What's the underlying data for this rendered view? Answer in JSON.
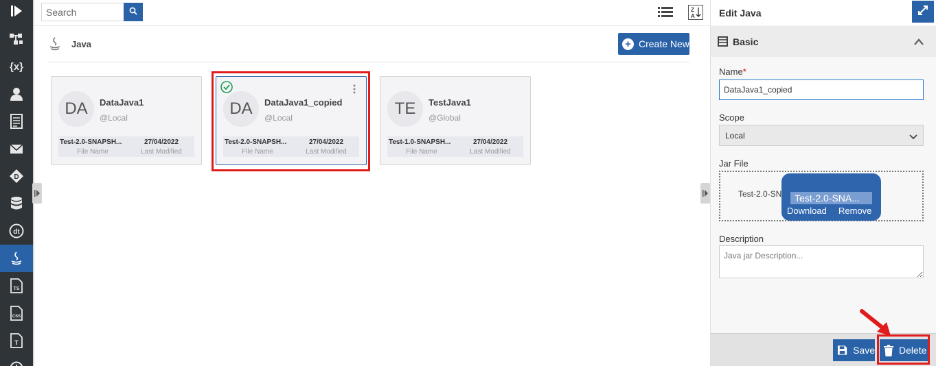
{
  "search": {
    "placeholder": "Search"
  },
  "header": {
    "title": "Java",
    "create_label": "Create New"
  },
  "cards": [
    {
      "initials": "DA",
      "name": "DataJava1",
      "scope": "@Local",
      "file": "Test-2.0-SNAPSH...",
      "date": "27/04/2022",
      "file_label": "File Name",
      "date_label": "Last Modified"
    },
    {
      "initials": "DA",
      "name": "DataJava1_copied",
      "scope": "@Local",
      "file": "Test-2.0-SNAPSH...",
      "date": "27/04/2022",
      "file_label": "File Name",
      "date_label": "Last Modified"
    },
    {
      "initials": "TE",
      "name": "TestJava1",
      "scope": "@Global",
      "file": "Test-1.0-SNAPSH...",
      "date": "27/04/2022",
      "file_label": "File Name",
      "date_label": "Last Modified"
    }
  ],
  "panel": {
    "title": "Edit Java",
    "section": "Basic",
    "name_label": "Name",
    "required_mark": "*",
    "name_value": "DataJava1_copied",
    "scope_label": "Scope",
    "scope_value": "Local",
    "jar_label": "Jar File",
    "jar_file_behind": "Test-2.0-SN",
    "jar_file_popup": "Test-2.0-SNA...",
    "download_label": "Download",
    "remove_label": "Remove",
    "description_label": "Description",
    "description_placeholder": "Java jar Description...",
    "save_label": "Save",
    "delete_label": "Delete"
  },
  "colors": {
    "accent": "#2a62a8",
    "rail": "#2f3438",
    "highlight": "#e01b1b",
    "success": "#1e9e55"
  },
  "rail_icons": [
    "logo-icon",
    "workflow-icon",
    "variables-icon",
    "user-icon",
    "document-icon",
    "mail-icon",
    "diamond-icon",
    "database-icon",
    "dt-icon",
    "java-icon",
    "ts-file-icon",
    "css-file-icon",
    "text-file-icon",
    "clock-icon"
  ]
}
